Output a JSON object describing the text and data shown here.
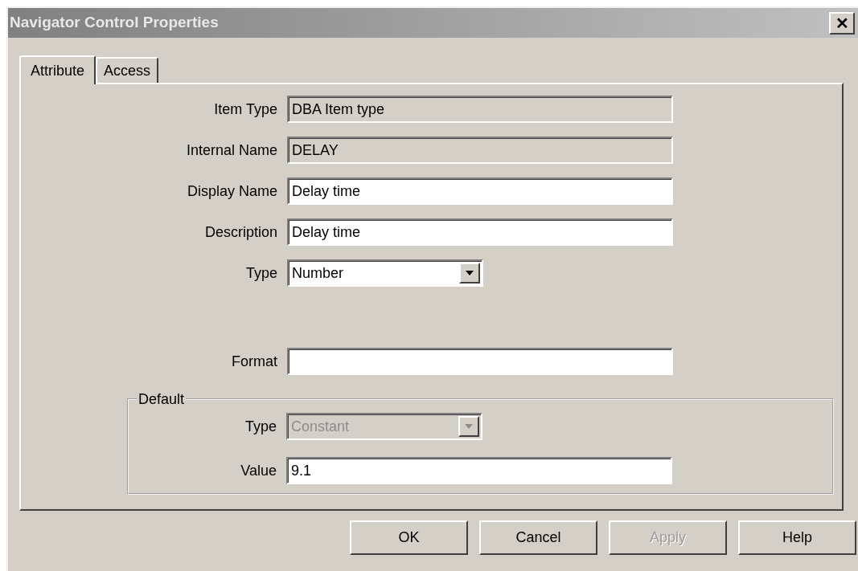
{
  "window": {
    "title": "Navigator Control Properties",
    "close": "✕"
  },
  "tabs": [
    {
      "label": "Attribute",
      "selected": true
    },
    {
      "label": "Access",
      "selected": false
    }
  ],
  "fields": [
    {
      "kind": "readonly",
      "label": "Item Type",
      "value": "DBA Item type"
    },
    {
      "kind": "readonly",
      "label": "Internal Name",
      "value": "DELAY"
    },
    {
      "kind": "text",
      "label": "Display Name",
      "value": "Delay time"
    },
    {
      "kind": "text",
      "label": "Description",
      "value": "Delay time"
    },
    {
      "kind": "select",
      "label": "Type",
      "value": "Number",
      "disabled": false
    },
    {
      "kind": "text",
      "label": "Format"
    }
  ],
  "default_group": {
    "title": "Default",
    "fields": [
      {
        "kind": "select",
        "label": "Type",
        "value": "Constant",
        "disabled": true
      },
      {
        "kind": "text",
        "label": "Value",
        "value": "9.1"
      }
    ]
  },
  "buttons": [
    {
      "label": "OK",
      "disabled": false
    },
    {
      "label": "Cancel",
      "disabled": false
    },
    {
      "label": "Apply",
      "disabled": true
    },
    {
      "label": "Help",
      "disabled": false
    }
  ]
}
